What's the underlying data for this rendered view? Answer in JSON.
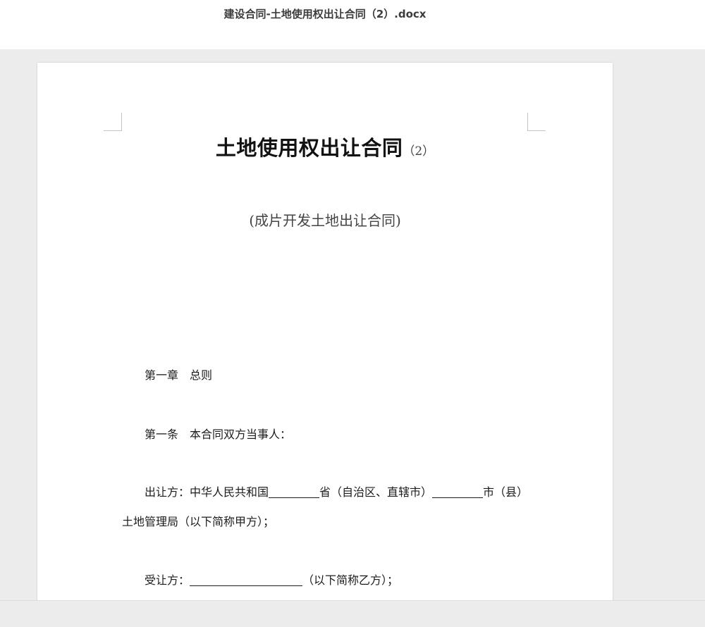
{
  "window": {
    "file_title": "建设合同-土地使用权出让合同（2）.docx"
  },
  "document": {
    "title_main": "土地使用权出让合同",
    "title_suffix": "（2）",
    "subtitle": "(成片开发土地出让合同)",
    "chapter": {
      "number": "第一章",
      "name": "总则"
    },
    "article": {
      "number": "第一条",
      "text": "本合同双方当事人："
    },
    "grantor": {
      "label": "出让方：",
      "country": "中华人民共和国",
      "province": "省（自治区、直辖市）",
      "city": "市（县）",
      "line2": "土地管理局（以下简称甲方）；"
    },
    "grantee": {
      "label": "受让方：",
      "suffix": "（以下简称乙方）；"
    }
  },
  "colors": {
    "background": "#ececec",
    "page": "#ffffff",
    "text": "#1c1c1c"
  }
}
